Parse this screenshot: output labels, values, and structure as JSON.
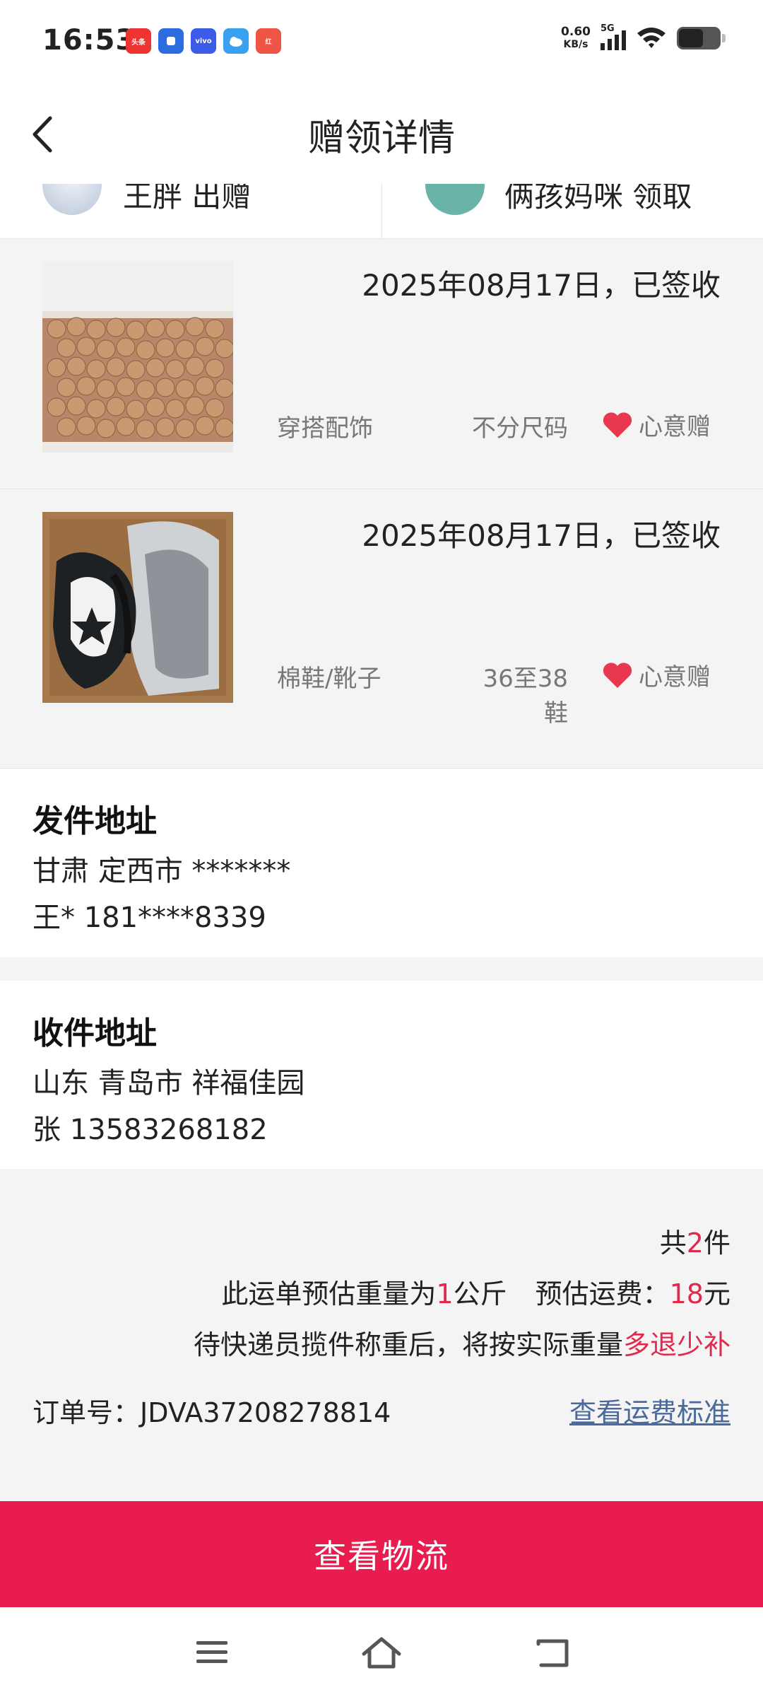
{
  "status_bar": {
    "time": "16:53",
    "notifications": [
      {
        "icon": "toutiao-app-icon",
        "label": "头条"
      },
      {
        "icon": "blue-app-icon",
        "label": ""
      },
      {
        "icon": "vivo-app-icon",
        "label": "vivo"
      },
      {
        "icon": "weather-app-icon",
        "label": ""
      },
      {
        "icon": "red-app-icon",
        "label": "红"
      }
    ],
    "net_speed_value": "0.60",
    "net_speed_unit": "KB/s",
    "network_type": "5G"
  },
  "header": {
    "title": "赠领详情"
  },
  "partial_row": {
    "left_text": "王胖 出赠",
    "right_text": "俩孩妈咪 领取"
  },
  "items": [
    {
      "date_status": "2025年08月17日，已签收",
      "category": "穿搭配饰",
      "size": "不分尺码",
      "tag": "心意赠",
      "image": "walnuts-photo"
    },
    {
      "date_status": "2025年08月17日，已签收",
      "category": "棉鞋/靴子",
      "size": "36至38鞋",
      "tag": "心意赠",
      "image": "shoes-photo"
    }
  ],
  "sender": {
    "title": "发件地址",
    "region": "甘肃 定西市 *******",
    "contact": "王* 181****8339"
  },
  "receiver": {
    "title": "收件地址",
    "region": "山东 青岛市 祥福佳园",
    "contact": "张 13583268182"
  },
  "summary": {
    "count_prefix": "共",
    "count": "2",
    "count_suffix": "件",
    "weight_prefix": "此运单预估重量为",
    "weight": "1",
    "weight_suffix": "公斤",
    "fee_prefix": "预估运费：",
    "fee": "18",
    "fee_suffix": "元",
    "notice_prefix": "待快递员揽件称重后，将按实际重量",
    "notice_highlight": "多退少补",
    "order_label": "订单号：",
    "order_number": "JDVA37208278814",
    "fee_standard_link": "查看运费标准"
  },
  "actions": {
    "logistics_button": "查看物流"
  },
  "colors": {
    "accent": "#e81c4f",
    "highlight_red": "#e0294d",
    "link": "#4a6a9c",
    "heart": "#e8384f"
  }
}
